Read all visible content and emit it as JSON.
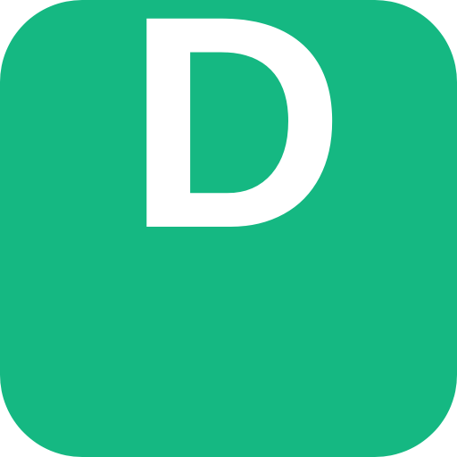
{
  "app_icon": {
    "letter": "D",
    "background_color": "#15b882",
    "letter_color": "#ffffff"
  }
}
